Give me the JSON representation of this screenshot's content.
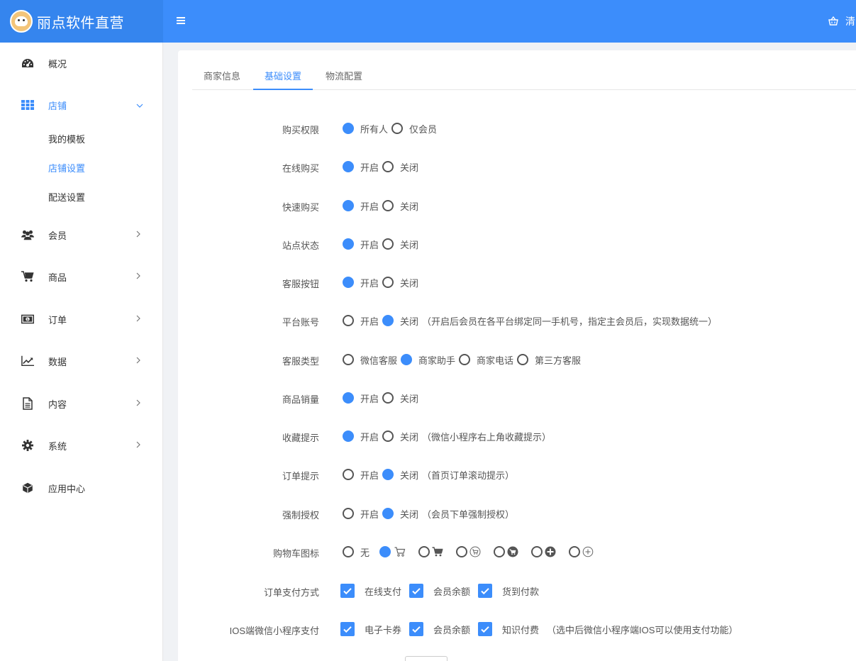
{
  "header": {
    "brand_name": "丽点软件直营",
    "right_text": "清"
  },
  "sidebar": {
    "items": [
      {
        "label": "概况",
        "icon": "dashboard-icon"
      },
      {
        "label": "店铺",
        "icon": "grid-icon",
        "expanded": true
      },
      {
        "label": "会员",
        "icon": "users-icon"
      },
      {
        "label": "商品",
        "icon": "cart-icon"
      },
      {
        "label": "订单",
        "icon": "money-icon"
      },
      {
        "label": "数据",
        "icon": "chart-line-icon"
      },
      {
        "label": "内容",
        "icon": "document-icon"
      },
      {
        "label": "系统",
        "icon": "gear-icon"
      },
      {
        "label": "应用中心",
        "icon": "cube-icon"
      }
    ],
    "subitems": [
      "我的模板",
      "店铺设置",
      "配送设置"
    ],
    "active_subitem": "店铺设置"
  },
  "tabs": [
    "商家信息",
    "基础设置",
    "物流配置"
  ],
  "active_tab": "基础设置",
  "accent_color": "#3c8dfb",
  "form": {
    "purchase_permission": {
      "label": "购买权限",
      "options": [
        "所有人",
        "仅会员"
      ],
      "selected": "所有人"
    },
    "online_purchase": {
      "label": "在线购买",
      "options": [
        "开启",
        "关闭"
      ],
      "selected": "开启"
    },
    "quick_purchase": {
      "label": "快速购买",
      "options": [
        "开启",
        "关闭"
      ],
      "selected": "开启"
    },
    "site_status": {
      "label": "站点状态",
      "options": [
        "开启",
        "关闭"
      ],
      "selected": "开启"
    },
    "service_button": {
      "label": "客服按钮",
      "options": [
        "开启",
        "关闭"
      ],
      "selected": "开启"
    },
    "platform_account": {
      "label": "平台账号",
      "options": [
        "开启",
        "关闭"
      ],
      "selected": "关闭",
      "hint": "（开启后会员在各平台绑定同一手机号，指定主会员后，实现数据统一）"
    },
    "service_type": {
      "label": "客服类型",
      "options": [
        "微信客服",
        "商家助手",
        "商家电话",
        "第三方客服"
      ],
      "selected": "商家助手"
    },
    "product_sales": {
      "label": "商品销量",
      "options": [
        "开启",
        "关闭"
      ],
      "selected": "开启"
    },
    "favorite_tip": {
      "label": "收藏提示",
      "options": [
        "开启",
        "关闭"
      ],
      "selected": "开启",
      "hint": "（微信小程序右上角收藏提示）"
    },
    "order_tip": {
      "label": "订单提示",
      "options": [
        "开启",
        "关闭"
      ],
      "selected": "关闭",
      "hint": "（首页订单滚动提示）"
    },
    "force_auth": {
      "label": "强制授权",
      "options": [
        "开启",
        "关闭"
      ],
      "selected": "关闭",
      "hint": "（会员下单强制授权）"
    },
    "cart_icon": {
      "label": "购物车图标",
      "none_label": "无",
      "selected_index": 1,
      "icons": [
        "cart-outline-icon",
        "cart-solid-icon",
        "cart-circle-outline-icon",
        "cart-circle-solid-icon",
        "plus-circle-solid-icon",
        "plus-circle-outline-icon"
      ]
    },
    "order_payment": {
      "label": "订单支付方式",
      "options": [
        "在线支付",
        "会员余额",
        "货到付款"
      ],
      "checked": [
        true,
        true,
        true
      ]
    },
    "ios_payment": {
      "label": "IOS端微信小程序支付",
      "options": [
        "电子卡券",
        "会员余额",
        "知识付费"
      ],
      "checked": [
        true,
        true,
        true
      ],
      "hint": "（选中后微信小程序端IOS可以使用支付功能）"
    }
  }
}
